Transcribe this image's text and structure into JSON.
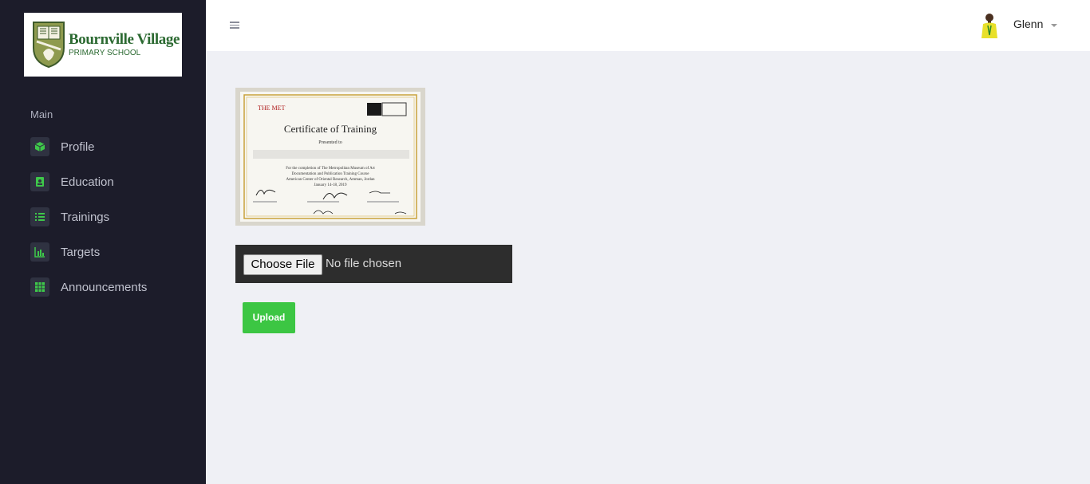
{
  "logo": {
    "title": "Bournville Village",
    "subtitle": "PRIMARY SCHOOL"
  },
  "sidebar": {
    "heading": "Main",
    "items": [
      {
        "label": "Profile",
        "icon": "cube-icon"
      },
      {
        "label": "Education",
        "icon": "id-badge-icon"
      },
      {
        "label": "Trainings",
        "icon": "list-icon"
      },
      {
        "label": "Targets",
        "icon": "bar-chart-icon"
      },
      {
        "label": "Announcements",
        "icon": "table-grid-icon"
      }
    ]
  },
  "header": {
    "user_name": "Glenn"
  },
  "certificate": {
    "org": "THE MET",
    "title": "Certificate of Training",
    "presented": "Presented to",
    "line1": "For the completion of The Metropolitan Museum of Art",
    "line2": "Documentation and Publication Training Course",
    "line3": "American Center of Oriental Research, Amman, Jordan",
    "line4": "January 14-18, 2019"
  },
  "upload": {
    "choose_label": "Choose File",
    "status": "No file chosen",
    "button_label": "Upload"
  },
  "colors": {
    "sidebar_bg": "#1c1c2a",
    "accent_green": "#3cc643",
    "nav_icon_green": "#3ec84a",
    "content_bg": "#eff0f5"
  }
}
